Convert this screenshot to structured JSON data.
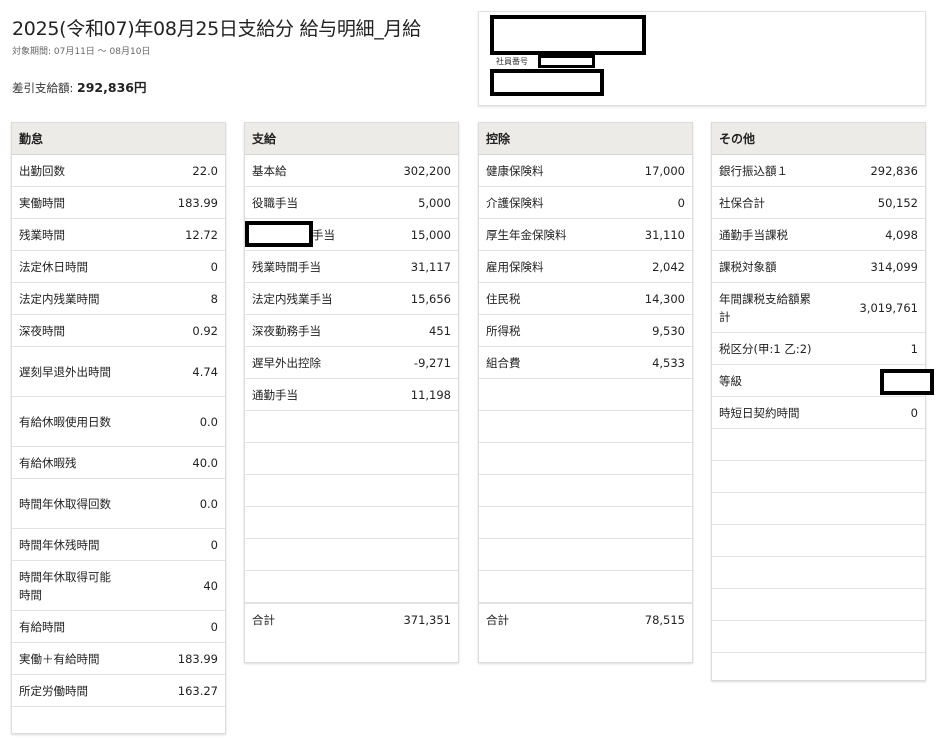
{
  "header": {
    "title": "2025(令和07)年08月25日支給分 給与明細_月給",
    "period": "対象期間: 07月11日 〜 08月10日",
    "net_label": "差引支給額:",
    "net_value": "292,836円"
  },
  "employee": {
    "id_label": "社員番号"
  },
  "attendance": {
    "title": "勤怠",
    "rows": [
      {
        "label": "出勤回数",
        "value": "22.0"
      },
      {
        "label": "実働時間",
        "value": "183.99"
      },
      {
        "label": "残業時間",
        "value": "12.72"
      },
      {
        "label": "法定休日時間",
        "value": "0"
      },
      {
        "label": "法定内残業時間",
        "value": "8"
      },
      {
        "label": "深夜時間",
        "value": "0.92"
      },
      {
        "label": "遅刻早退外出時間",
        "value": "4.74"
      },
      {
        "label": "有給休暇使用日数",
        "value": "0.0"
      },
      {
        "label": "有給休暇残",
        "value": "40.0"
      },
      {
        "label": "時間年休取得回数",
        "value": "0.0"
      },
      {
        "label": "時間年休残時間",
        "value": "0"
      },
      {
        "label": "時間年休取得可能時間",
        "value": "40"
      },
      {
        "label": "有給時間",
        "value": "0"
      },
      {
        "label": "実働＋有給時間",
        "value": "183.99"
      },
      {
        "label": "所定労働時間",
        "value": "163.27"
      }
    ]
  },
  "payments": {
    "title": "支給",
    "rows": [
      {
        "label": "基本給",
        "value": "302,200"
      },
      {
        "label": "役職手当",
        "value": "5,000"
      },
      {
        "label": "手当",
        "value": "15,000"
      },
      {
        "label": "残業時間手当",
        "value": "31,117"
      },
      {
        "label": "法定内残業手当",
        "value": "15,656"
      },
      {
        "label": "深夜勤務手当",
        "value": "451"
      },
      {
        "label": "遅早外出控除",
        "value": "-9,271"
      },
      {
        "label": "通勤手当",
        "value": "11,198"
      }
    ],
    "total_label": "合計",
    "total_value": "371,351"
  },
  "deductions": {
    "title": "控除",
    "rows": [
      {
        "label": "健康保険料",
        "value": "17,000"
      },
      {
        "label": "介護保険料",
        "value": "0"
      },
      {
        "label": "厚生年金保険料",
        "value": "31,110"
      },
      {
        "label": "雇用保険料",
        "value": "2,042"
      },
      {
        "label": "住民税",
        "value": "14,300"
      },
      {
        "label": "所得税",
        "value": "9,530"
      },
      {
        "label": "組合費",
        "value": "4,533"
      }
    ],
    "total_label": "合計",
    "total_value": "78,515"
  },
  "other": {
    "title": "その他",
    "rows": [
      {
        "label": "銀行振込額１",
        "value": "292,836"
      },
      {
        "label": "社保合計",
        "value": "50,152"
      },
      {
        "label": "通勤手当課税",
        "value": "4,098"
      },
      {
        "label": "課税対象額",
        "value": "314,099"
      },
      {
        "label": "年間課税支給額累計",
        "value": "3,019,761"
      },
      {
        "label": "税区分(甲:1 乙:2)",
        "value": "1"
      },
      {
        "label": "等級",
        "value": ""
      },
      {
        "label": "時短日契約時間",
        "value": "0"
      }
    ]
  }
}
